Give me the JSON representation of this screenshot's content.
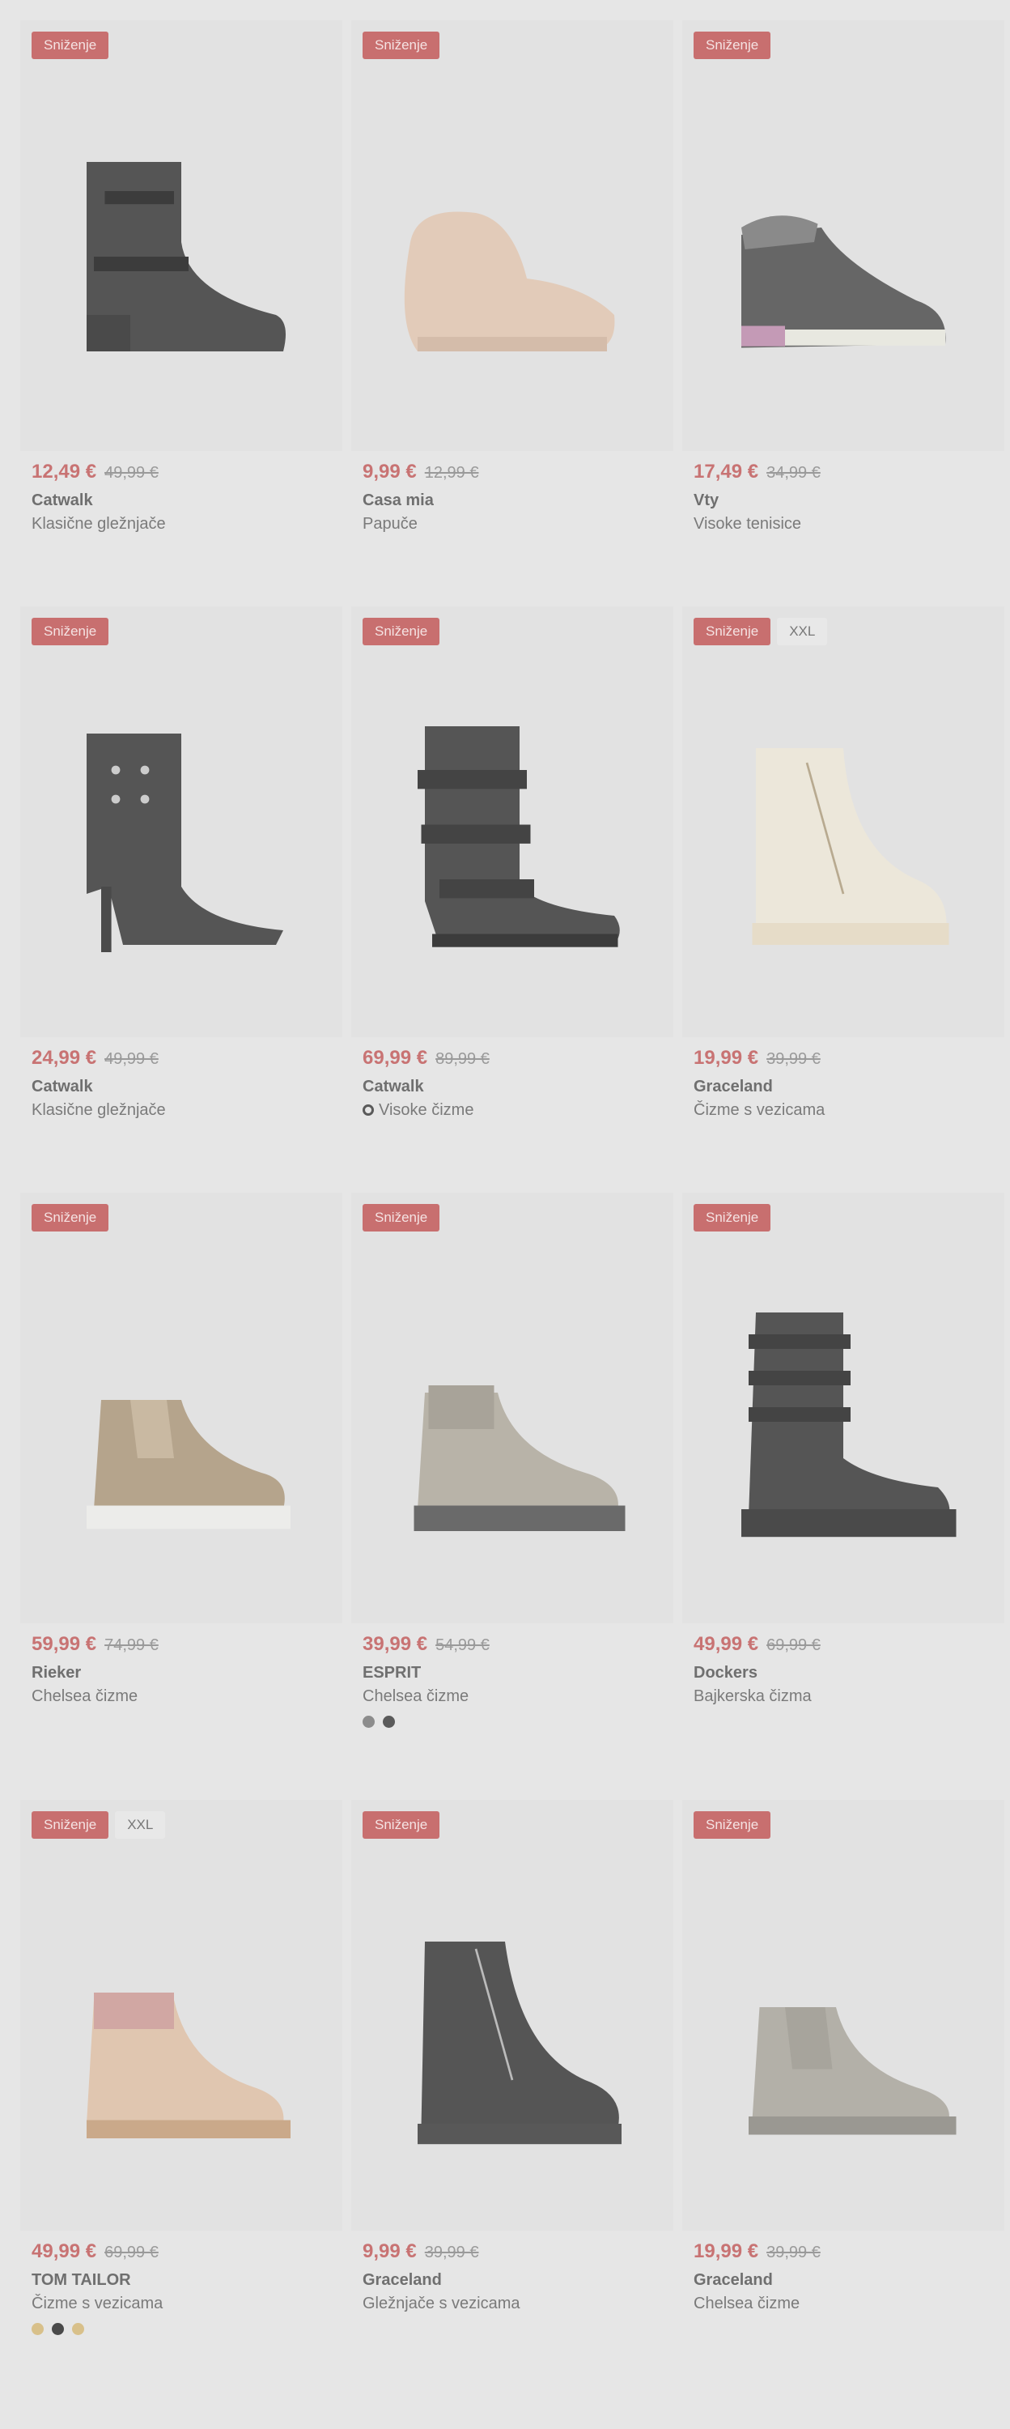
{
  "products": [
    {
      "badges": [
        "Sniženje"
      ],
      "price": "12,49 €",
      "old_price": "49,99 €",
      "brand": "Catwalk",
      "category": "Klasične gležnjače",
      "category_icon": "",
      "swatches": [],
      "image": "heel-ankle-boot-black"
    },
    {
      "badges": [
        "Sniženje"
      ],
      "price": "9,99 €",
      "old_price": "12,99 €",
      "brand": "Casa mia",
      "category": "Papuče",
      "category_icon": "",
      "swatches": [],
      "image": "fluffy-slipper-beige"
    },
    {
      "badges": [
        "Sniženje"
      ],
      "price": "17,49 €",
      "old_price": "34,99 €",
      "brand": "Vty",
      "category": "Visoke tenisice",
      "category_icon": "",
      "swatches": [],
      "image": "high-sneaker-grey"
    },
    {
      "badges": [
        "Sniženje"
      ],
      "price": "24,99 €",
      "old_price": "49,99 €",
      "brand": "Catwalk",
      "category": "Klasične gležnjače",
      "category_icon": "",
      "swatches": [],
      "image": "stiletto-boot-black"
    },
    {
      "badges": [
        "Sniženje"
      ],
      "price": "69,99 €",
      "old_price": "89,99 €",
      "brand": "Catwalk",
      "category": "Visoke čizme",
      "category_icon": "sustainability-icon",
      "swatches": [],
      "image": "buckle-boot-black"
    },
    {
      "badges": [
        "Sniženje",
        "XXL"
      ],
      "price": "19,99 €",
      "old_price": "39,99 €",
      "brand": "Graceland",
      "category": "Čizme s vezicama",
      "category_icon": "",
      "swatches": [],
      "image": "lace-boot-cream"
    },
    {
      "badges": [
        "Sniženje"
      ],
      "price": "59,99 €",
      "old_price": "74,99 €",
      "brand": "Rieker",
      "category": "Chelsea čizme",
      "category_icon": "",
      "swatches": [],
      "image": "chelsea-taupe"
    },
    {
      "badges": [
        "Sniženje"
      ],
      "price": "39,99 €",
      "old_price": "54,99 €",
      "brand": "ESPRIT",
      "category": "Chelsea čizme",
      "category_icon": "",
      "swatches": [
        "#8c8c8c",
        "#5a5a5a"
      ],
      "image": "chelsea-grey"
    },
    {
      "badges": [
        "Sniženje"
      ],
      "price": "49,99 €",
      "old_price": "69,99 €",
      "brand": "Dockers",
      "category": "Bajkerska čizma",
      "category_icon": "",
      "swatches": [],
      "image": "biker-boot-black"
    },
    {
      "badges": [
        "Sniženje",
        "XXL"
      ],
      "price": "49,99 €",
      "old_price": "69,99 €",
      "brand": "TOM TAILOR",
      "category": "Čizme s vezicama",
      "category_icon": "",
      "swatches": [
        "#d8c08a",
        "#4a4a4a",
        "#d8c08a"
      ],
      "image": "lace-boot-pink"
    },
    {
      "badges": [
        "Sniženje"
      ],
      "price": "9,99 €",
      "old_price": "39,99 €",
      "brand": "Graceland",
      "category": "Gležnjače s vezicama",
      "category_icon": "",
      "swatches": [],
      "image": "lace-boot-black"
    },
    {
      "badges": [
        "Sniženje"
      ],
      "price": "19,99 €",
      "old_price": "39,99 €",
      "brand": "Graceland",
      "category": "Chelsea čizme",
      "category_icon": "",
      "swatches": [],
      "image": "chelsea-light-grey"
    }
  ]
}
